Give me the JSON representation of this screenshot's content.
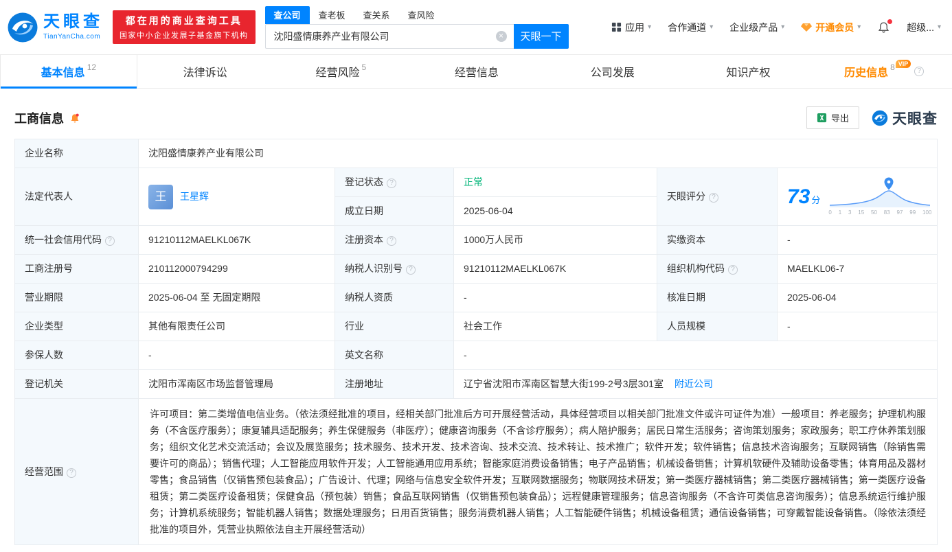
{
  "icons": {
    "help": "?",
    "clear": "×",
    "caret": "▾"
  },
  "colors": {
    "accent_blue": "#0084ff",
    "status_green": "#00b578",
    "vip_orange": "#ff8a00",
    "badge_red": "#e8252e",
    "link_blue": "#0084ff"
  },
  "header": {
    "logo": {
      "title": "天眼查",
      "subtitle": "TianYanCha.com"
    },
    "badge": {
      "line1": "都在用的商业查询工具",
      "line2": "国家中小企业发展子基金旗下机构"
    },
    "search": {
      "tabs": [
        {
          "label": "查公司"
        },
        {
          "label": "查老板"
        },
        {
          "label": "查关系"
        },
        {
          "label": "查风险"
        }
      ],
      "value": "沈阳盛情康养产业有限公司",
      "button": "天眼一下"
    },
    "nav": {
      "apps": "应用",
      "partner": "合作通道",
      "enterprise": "企业级产品",
      "vip": "开通会员",
      "super": "超级..."
    }
  },
  "tabs": [
    {
      "label": "基本信息",
      "count": "12"
    },
    {
      "label": "法律诉讼",
      "count": ""
    },
    {
      "label": "经营风险",
      "count": "5"
    },
    {
      "label": "经营信息",
      "count": ""
    },
    {
      "label": "公司发展",
      "count": ""
    },
    {
      "label": "知识产权",
      "count": ""
    },
    {
      "label": "历史信息",
      "count": "8",
      "vip_tag": "VIP"
    }
  ],
  "section": {
    "title": "工商信息",
    "export_label": "导出",
    "brand": "天眼查"
  },
  "info": {
    "company_name": {
      "label": "企业名称",
      "value": "沈阳盛情康养产业有限公司"
    },
    "legal_rep": {
      "label": "法定代表人",
      "avatar": "王",
      "name": "王星辉"
    },
    "reg_status": {
      "label": "登记状态",
      "value": "正常"
    },
    "est_date": {
      "label": "成立日期",
      "value": "2025-06-04"
    },
    "score": {
      "label": "天眼评分",
      "value": "73",
      "unit": "分"
    },
    "credit_code": {
      "label": "统一社会信用代码",
      "value": "91210112MAELKL067K"
    },
    "reg_capital": {
      "label": "注册资本",
      "value": "1000万人民币"
    },
    "paid_capital": {
      "label": "实缴资本",
      "value": "-"
    },
    "reg_number": {
      "label": "工商注册号",
      "value": "210112000794299"
    },
    "taxpayer_id": {
      "label": "纳税人识别号",
      "value": "91210112MAELKL067K"
    },
    "org_code": {
      "label": "组织机构代码",
      "value": "MAELKL06-7"
    },
    "business_term": {
      "label": "营业期限",
      "value": "2025-06-04 至 无固定期限"
    },
    "taxpayer_quality": {
      "label": "纳税人资质",
      "value": "-"
    },
    "approval_date": {
      "label": "核准日期",
      "value": "2025-06-04"
    },
    "company_type": {
      "label": "企业类型",
      "value": "其他有限责任公司"
    },
    "industry": {
      "label": "行业",
      "value": "社会工作"
    },
    "staff_size": {
      "label": "人员规模",
      "value": "-"
    },
    "insured_count": {
      "label": "参保人数",
      "value": "-"
    },
    "english_name": {
      "label": "英文名称",
      "value": "-"
    },
    "reg_authority": {
      "label": "登记机关",
      "value": "沈阳市浑南区市场监督管理局"
    },
    "reg_address": {
      "label": "注册地址",
      "value": "辽宁省沈阳市浑南区智慧大街199-2号3层301室",
      "nearby": "附近公司"
    },
    "business_scope": {
      "label": "经营范围",
      "value": "许可项目：第二类增值电信业务。（依法须经批准的项目，经相关部门批准后方可开展经营活动，具体经营项目以相关部门批准文件或许可证件为准）一般项目：养老服务；护理机构服务（不含医疗服务）；康复辅具适配服务；养生保健服务（非医疗）；健康咨询服务（不含诊疗服务）；病人陪护服务；居民日常生活服务；咨询策划服务；家政服务；职工疗休养策划服务；组织文化艺术交流活动；会议及展览服务；技术服务、技术开发、技术咨询、技术交流、技术转让、技术推广；软件开发；软件销售；信息技术咨询服务；互联网销售（除销售需要许可的商品）；销售代理；人工智能应用软件开发；人工智能通用应用系统；智能家庭消费设备销售；电子产品销售；机械设备销售；计算机软硬件及辅助设备零售；体育用品及器材零售；食品销售（仅销售预包装食品）；广告设计、代理；网络与信息安全软件开发；互联网数据服务；物联网技术研发；第一类医疗器械销售；第二类医疗器械销售；第一类医疗设备租赁；第二类医疗设备租赁；保健食品（预包装）销售；食品互联网销售（仅销售预包装食品）；远程健康管理服务；信息咨询服务（不含许可类信息咨询服务）；信息系统运行维护服务；计算机系统服务；智能机器人销售；数据处理服务；日用百货销售；服务消费机器人销售；人工智能硬件销售；机械设备租赁；通信设备销售；可穿戴智能设备销售。（除依法须经批准的项目外，凭营业执照依法自主开展经营活动）"
    }
  },
  "score_chart": {
    "axis": [
      "0",
      "1",
      "3",
      "15",
      "50",
      "83",
      "97",
      "99",
      "100"
    ]
  }
}
